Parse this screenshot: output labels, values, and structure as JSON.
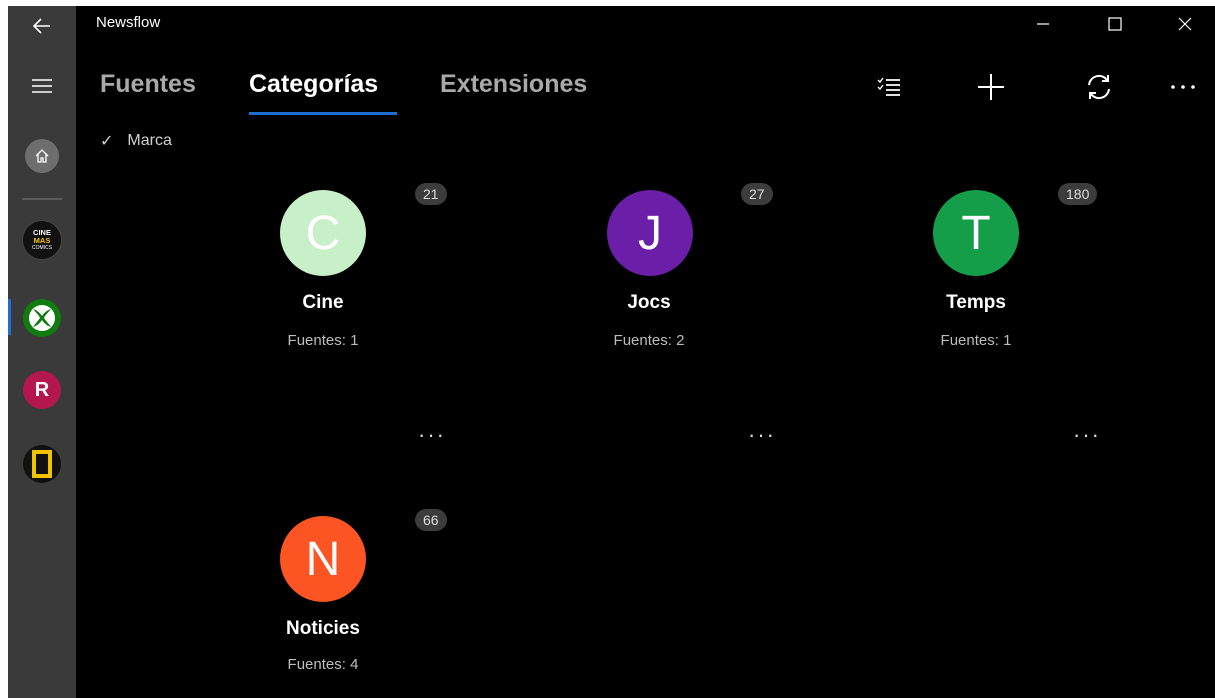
{
  "window": {
    "title": "Newsflow"
  },
  "nav": {
    "pivots": [
      {
        "label": "Fuentes"
      },
      {
        "label": "Categorías"
      },
      {
        "label": "Extensiones"
      }
    ]
  },
  "filter": {
    "label": "Marca"
  },
  "sources": {
    "cine": {
      "line1": "CINE",
      "line2": "MAS",
      "line3": "COMICS"
    },
    "r": {
      "letter": "R"
    }
  },
  "categories": [
    {
      "name": "Cine",
      "initial": "C",
      "count_label": "Fuentes: 1",
      "badge": "21",
      "color": "#c8f0c8"
    },
    {
      "name": "Jocs",
      "initial": "J",
      "count_label": "Fuentes: 2",
      "badge": "27",
      "color": "#6b1fa8"
    },
    {
      "name": "Temps",
      "initial": "T",
      "count_label": "Fuentes: 1",
      "badge": "180",
      "color": "#149e4a"
    },
    {
      "name": "Noticies",
      "initial": "N",
      "count_label": "Fuentes: 4",
      "badge": "66",
      "color": "#fc5423"
    }
  ],
  "more_glyph": "···"
}
